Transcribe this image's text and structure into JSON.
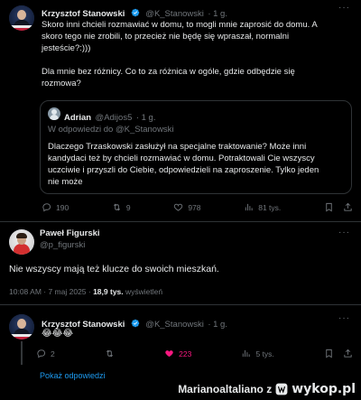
{
  "tweet1": {
    "name": "Krzysztof Stanowski",
    "handle": "@K_Stanowski",
    "time": "· 1 g.",
    "text_line1": "Skoro inni chcieli rozmawiać w domu, to mogli mnie zaprosić do domu. A",
    "text_line2": "skoro tego nie zrobili, to przecież nie będę się wpraszał, normalni",
    "text_line3": "jesteście?:)))",
    "text_line4": "Dla mnie bez różnicy. Co to za różnica w ogóle, gdzie odbędzie się",
    "text_line5": "rozmowa?",
    "quote": {
      "name": "Adrian",
      "handle": "@Adijos5",
      "time": "· 1 g.",
      "reply_to": "W odpowiedzi do @K_Stanowski",
      "text_line1": "Dlaczego Trzaskowski zasłużył na specjalne traktowanie? Może inni",
      "text_line2": "kandydaci też by chcieli rozmawiać w domu. Potraktowali Cie wszyscy",
      "text_line3": "uczciwie i przyszli do Ciebie, odpowiedzieli na zaproszenie. Tylko jeden",
      "text_line4": "nie może"
    },
    "replies": "190",
    "retweets": "9",
    "likes": "978",
    "views": "81 tys."
  },
  "tweet2": {
    "name": "Paweł Figurski",
    "handle": "@p_figurski",
    "text": "Nie wszyscy mają też klucze do swoich mieszkań.",
    "timestamp": "10:08 AM · 7 maj 2025 · ",
    "views_count": "18,9 tys.",
    "views_label": " wyświetleń"
  },
  "tweet3": {
    "name": "Krzysztof Stanowski",
    "handle": "@K_Stanowski",
    "time": "· 1 g.",
    "text": "😂😂😂",
    "replies": "2",
    "likes": "223",
    "views": "5 tys.",
    "show_replies": "Pokaż odpowiedzi"
  },
  "watermark": {
    "user": "Marianoaltaliano z",
    "site": "wykop.pl"
  },
  "colors": {
    "accent": "#1d9bf0",
    "like": "#f91880",
    "muted": "#71767b"
  }
}
